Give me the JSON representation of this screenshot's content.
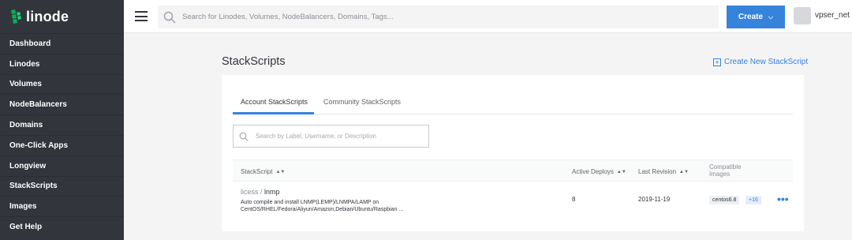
{
  "app": {
    "logo_text": "linode"
  },
  "sidebar": {
    "items": [
      {
        "label": "Dashboard"
      },
      {
        "label": "Linodes"
      },
      {
        "label": "Volumes"
      },
      {
        "label": "NodeBalancers"
      },
      {
        "label": "Domains"
      },
      {
        "label": "One-Click Apps"
      },
      {
        "label": "Longview"
      },
      {
        "label": "StackScripts"
      },
      {
        "label": "Images"
      },
      {
        "label": "Get Help"
      }
    ]
  },
  "topbar": {
    "search_placeholder": "Search for Linodes, Volumes, NodeBalancers, Domains, Tags...",
    "create_label": "Create",
    "username": "vpser_net"
  },
  "page": {
    "title": "StackScripts",
    "create_link": "Create New StackScript"
  },
  "tabs": [
    {
      "label": "Account StackScripts",
      "active": true
    },
    {
      "label": "Community StackScripts",
      "active": false
    }
  ],
  "filter": {
    "placeholder": "Search by Label, Username, or Description"
  },
  "table": {
    "headers": {
      "stackscript": "StackScript",
      "active_deploys": "Active Deploys",
      "last_revision": "Last Revision",
      "compatible_images_1": "Compatible",
      "compatible_images_2": "Images"
    },
    "rows": [
      {
        "username": "licess",
        "separator": " / ",
        "label": "lnmp",
        "description_1": "Auto compile and install LNMP(LEMP)/LNMPA/LAMP on",
        "description_2": "CentOS/RHEL/Fedora/Aliyun/Amazon,Debian/Ubuntu/Raspbian ...",
        "active_deploys": "8",
        "last_revision": "2019-11-19",
        "image": "centos6.8",
        "more_images": "+16",
        "actions": "•••"
      }
    ]
  },
  "colors": {
    "accent": "#3683dc",
    "sidebar": "#32363c",
    "logo_green": "#02b159"
  }
}
